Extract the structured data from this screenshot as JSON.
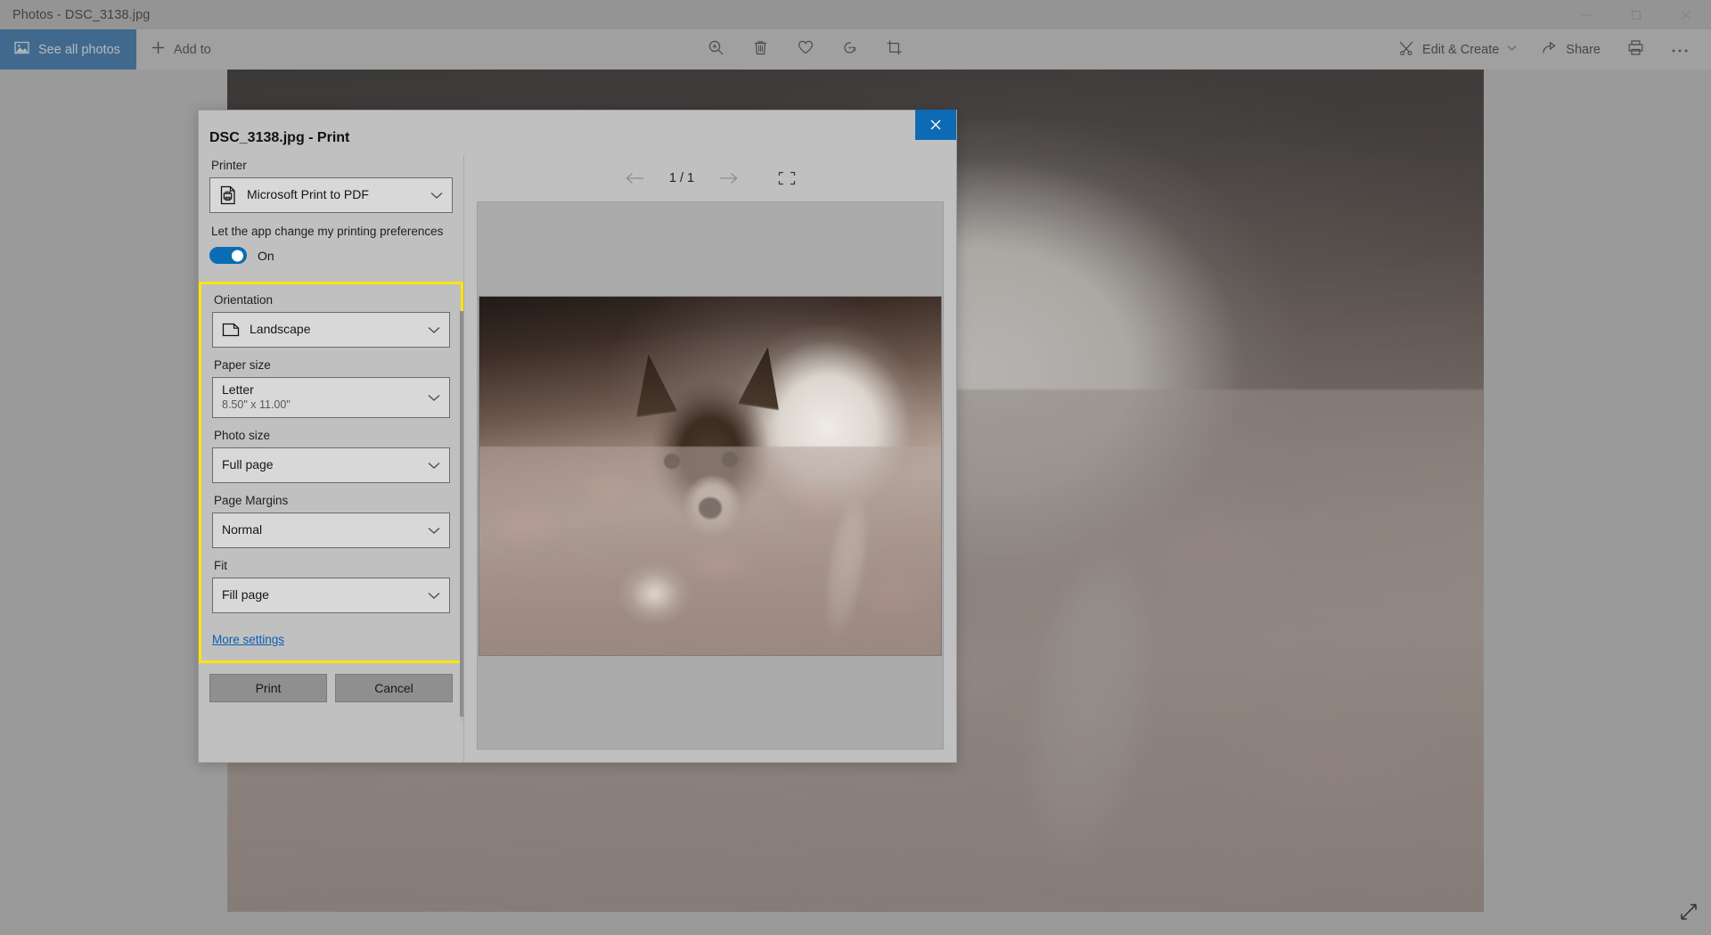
{
  "window": {
    "title": "Photos - DSC_3138.jpg",
    "controls": [
      {
        "name": "minimize",
        "glyph": "minimize-icon"
      },
      {
        "name": "maximize",
        "glyph": "maximize-icon"
      },
      {
        "name": "close",
        "glyph": "close-icon"
      }
    ]
  },
  "commandbar": {
    "see_all_photos": "See all photos",
    "add_to": "Add to",
    "center_icons": [
      {
        "name": "zoom-in-icon"
      },
      {
        "name": "delete-icon"
      },
      {
        "name": "favorite-heart-icon"
      },
      {
        "name": "rotate-icon"
      },
      {
        "name": "crop-icon"
      }
    ],
    "edit_create": "Edit & Create",
    "share": "Share",
    "print_icon": "print-icon",
    "more_icon": "more-ellipsis-icon"
  },
  "dialog": {
    "title": "DSC_3138.jpg - Print",
    "close_glyph": "✕",
    "printer": {
      "label": "Printer",
      "value": "Microsoft Print to PDF",
      "icon": "printer-pdf-icon"
    },
    "app_preferences": {
      "label": "Let the app change my printing preferences",
      "state": "On"
    },
    "highlighted_settings": [
      {
        "name": "orientation",
        "label": "Orientation",
        "value": "Landscape",
        "sub": "",
        "icon": "page-landscape-icon"
      },
      {
        "name": "paper-size",
        "label": "Paper size",
        "value": "Letter",
        "sub": "8.50\" x 11.00\"",
        "icon": ""
      },
      {
        "name": "photo-size",
        "label": "Photo size",
        "value": "Full page",
        "sub": "",
        "icon": ""
      },
      {
        "name": "page-margins",
        "label": "Page Margins",
        "value": "Normal",
        "sub": "",
        "icon": ""
      },
      {
        "name": "fit",
        "label": "Fit",
        "value": "Fill page",
        "sub": "",
        "icon": ""
      }
    ],
    "more_settings": "More settings",
    "buttons": {
      "print": "Print",
      "cancel": "Cancel"
    },
    "preview": {
      "page_counter": "1 / 1",
      "prev_icon": "arrow-left-icon",
      "next_icon": "arrow-right-icon",
      "fullscreen_icon": "fullscreen-icon"
    }
  },
  "viewer": {
    "resize_icon": "resize-diagonal-icon"
  },
  "colors": {
    "accent_blue": "#0a6cb5",
    "see_all_blue": "#1a5f9e",
    "highlight_yellow": "#ffe600",
    "link_blue": "#0c5fb5",
    "dialog_bg": "#c0c0c0",
    "command_bar_bg": "#bdbdbd",
    "titlebar_bg": "#aaaaaa"
  }
}
